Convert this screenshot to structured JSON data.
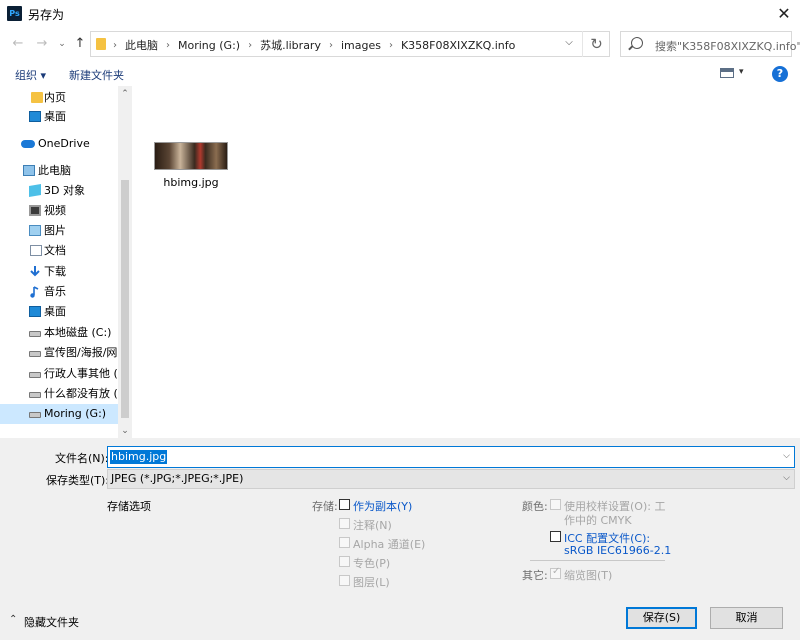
{
  "window": {
    "title": "另存为",
    "app_icon_text": "Ps",
    "close_glyph": "✕"
  },
  "nav_buttons": {
    "back": "←",
    "forward": "→",
    "up": "↑"
  },
  "address": {
    "crumbs": [
      "此电脑",
      "Moring (G:)",
      "苏城.library",
      "images",
      "K358F08XIXZKQ.info"
    ],
    "separator": "›",
    "dropdown_glyph": "⌵",
    "refresh_glyph": "↻"
  },
  "search": {
    "placeholder": "搜索\"K358F08XIXZKQ.info\""
  },
  "toolbar": {
    "organize": "组织 ▾",
    "new_folder": "新建文件夹",
    "view_dropdown": "▾",
    "help": "?"
  },
  "nav_pane": {
    "items": [
      {
        "label": "内页",
        "icon": "folder-icon"
      },
      {
        "label": "桌面",
        "icon": "desktop-icon"
      },
      {
        "label": "OneDrive",
        "icon": "onedrive-cloud-icon"
      },
      {
        "label": "此电脑",
        "icon": "this-pc-icon"
      },
      {
        "label": "3D 对象",
        "icon": "3d-objects-icon"
      },
      {
        "label": "视频",
        "icon": "video-icon"
      },
      {
        "label": "图片",
        "icon": "pictures-icon"
      },
      {
        "label": "文档",
        "icon": "documents-icon"
      },
      {
        "label": "下载",
        "icon": "download-icon"
      },
      {
        "label": "音乐",
        "icon": "music-icon"
      },
      {
        "label": "桌面",
        "icon": "desktop-icon"
      },
      {
        "label": "本地磁盘 (C:)",
        "icon": "drive-icon"
      },
      {
        "label": "宣传图/海报/网页",
        "icon": "drive-icon"
      },
      {
        "label": "行政人事其他 (E:",
        "icon": "drive-icon"
      },
      {
        "label": "什么都没有放 (F:",
        "icon": "drive-icon"
      },
      {
        "label": "Moring (G:)",
        "icon": "drive-icon"
      }
    ],
    "selected_label": "Moring (G:)"
  },
  "scrollbar": {
    "up": "⌃",
    "down": "⌄"
  },
  "files": [
    {
      "name": "hbimg.jpg",
      "thumbnail": "image-thumbnail"
    }
  ],
  "form": {
    "filename_label": "文件名(N):",
    "filename_value": "hbimg.jpg",
    "filetype_label": "保存类型(T):",
    "filetype_value": "JPEG (*.JPG;*.JPEG;*.JPE)",
    "dropdown_glyph": "⌵"
  },
  "options": {
    "section_label": "存储选项",
    "storage_label": "存储:",
    "as_copy": "作为副本(Y)",
    "notes": "注释(N)",
    "alpha": "Alpha 通道(E)",
    "spot": "专色(P)",
    "layers": "图层(L)",
    "color_label": "颜色:",
    "use_proof_line1": "使用校样设置(O): 工",
    "use_proof_line2": "作中的 CMYK",
    "icc_line1": "ICC 配置文件(C):",
    "icc_line2": "sRGB IEC61966-2.1",
    "other_label": "其它:",
    "thumbnail": "缩览图(T)"
  },
  "footer": {
    "hide_folders": "隐藏文件夹",
    "hide_chevron": "⌃",
    "save": "保存(S)",
    "cancel": "取消"
  },
  "colors": {
    "accent": "#0078d7",
    "link_blue": "#0a58c9",
    "selected_bg": "#cce8ff"
  }
}
